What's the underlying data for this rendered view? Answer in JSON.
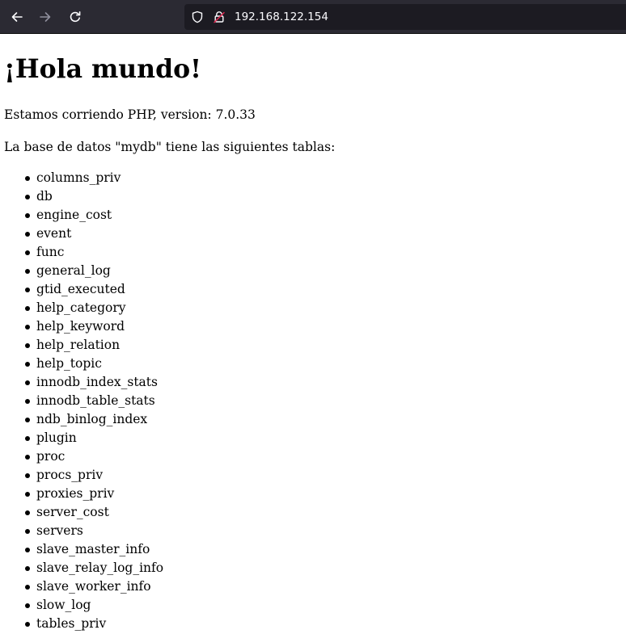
{
  "browser": {
    "url": "192.168.122.154",
    "icons": {
      "back": "arrow-left-icon",
      "forward": "arrow-right-icon",
      "reload": "reload-icon",
      "tracking": "shield-icon",
      "security": "insecure-lock-icon"
    },
    "colors": {
      "toolbar": "#2b2a33",
      "urlbar": "#1c1b22",
      "lock_accent": "#e22850"
    }
  },
  "page": {
    "heading": "¡Hola mundo!",
    "php_line": "Estamos corriendo PHP, version: 7.0.33",
    "db_line": "La base de datos \"mydb\" tiene las siguientes tablas:",
    "tables": [
      "columns_priv",
      "db",
      "engine_cost",
      "event",
      "func",
      "general_log",
      "gtid_executed",
      "help_category",
      "help_keyword",
      "help_relation",
      "help_topic",
      "innodb_index_stats",
      "innodb_table_stats",
      "ndb_binlog_index",
      "plugin",
      "proc",
      "procs_priv",
      "proxies_priv",
      "server_cost",
      "servers",
      "slave_master_info",
      "slave_relay_log_info",
      "slave_worker_info",
      "slow_log",
      "tables_priv"
    ]
  }
}
